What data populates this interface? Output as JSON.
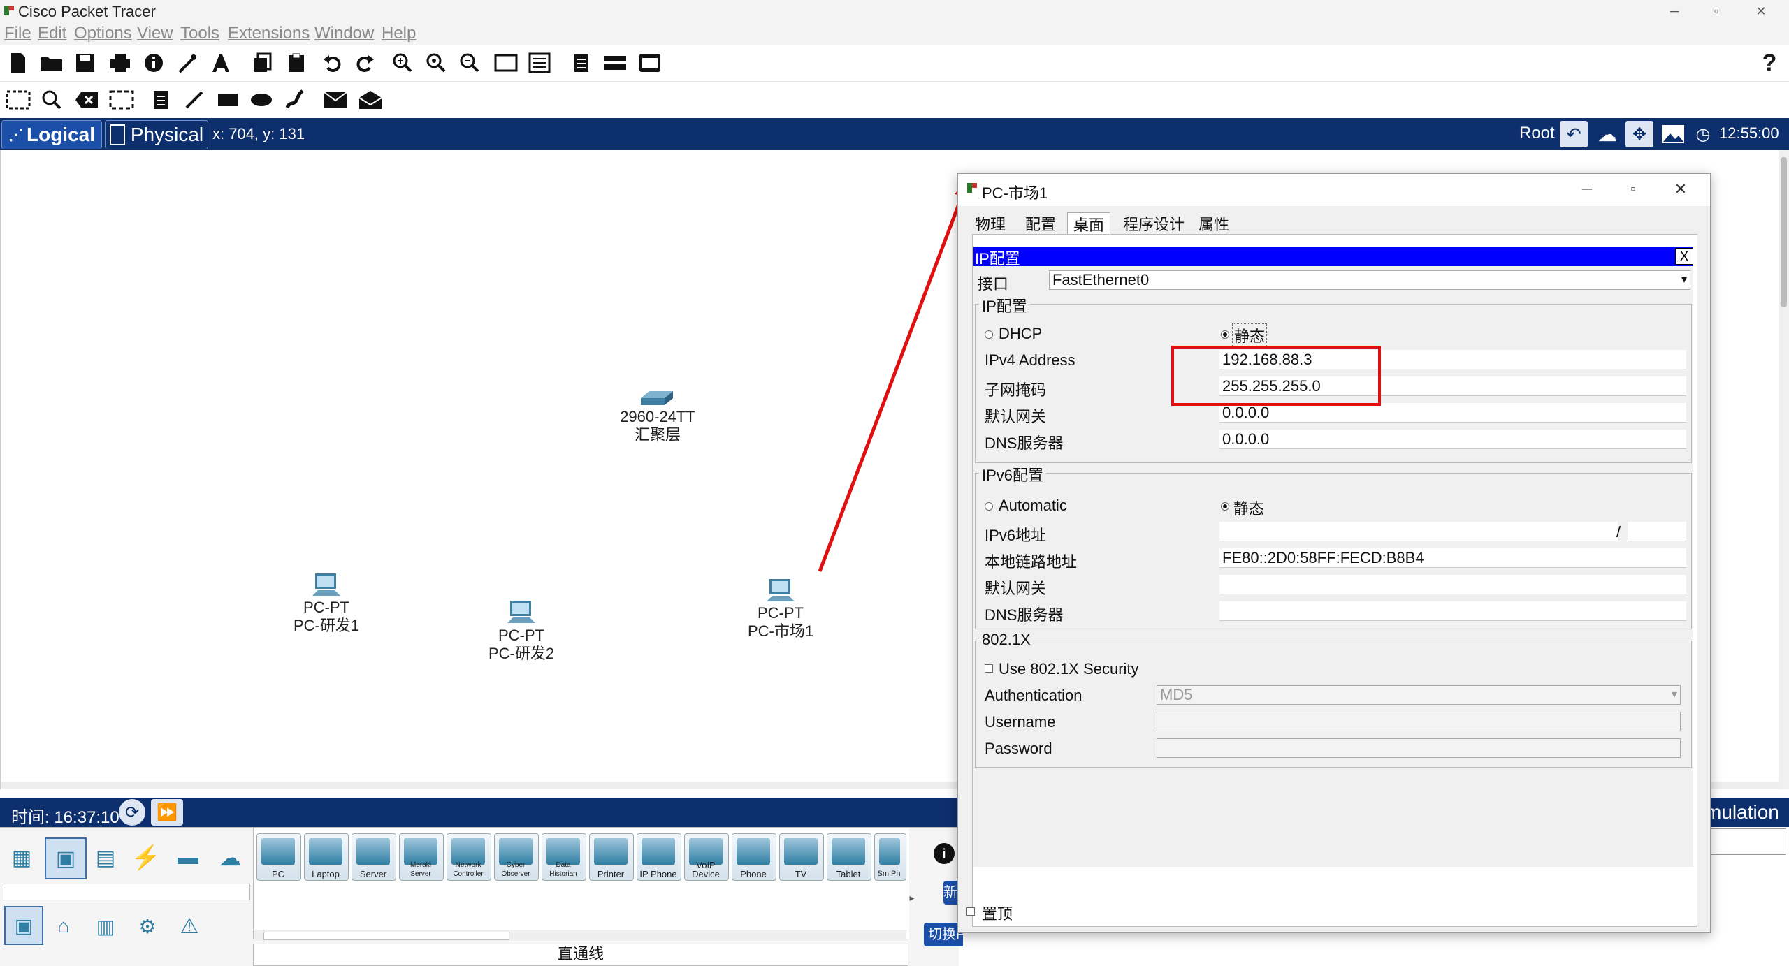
{
  "app": {
    "title": "Cisco Packet Tracer"
  },
  "menu": [
    "File",
    "Edit",
    "Options",
    "View",
    "Tools",
    "Extensions",
    "Window",
    "Help"
  ],
  "nav": {
    "logical_label": "Logical",
    "physical_label": "Physical",
    "coords": "x: 704, y: 131",
    "root_label": "Root",
    "clock": "12:55:00"
  },
  "devices": [
    {
      "model": "2960-24TT",
      "name": "汇聚层"
    },
    {
      "model": "PC-PT",
      "name": "PC-研发1"
    },
    {
      "model": "PC-PT",
      "name": "PC-研发2"
    },
    {
      "model": "PC-PT",
      "name": "PC-市场1"
    }
  ],
  "timebar": {
    "time_label": "时间: 16:37:10",
    "mode_label": "mulation"
  },
  "device_types": [
    "PC",
    "Laptop",
    "Server",
    "Meraki Server",
    "Network Controller",
    "Cyber Observer",
    "Data Historian",
    "Printer",
    "IP Phone",
    "VoIP Device",
    "Phone",
    "TV",
    "Tablet",
    "Sm Ph"
  ],
  "bottom": {
    "connection_label": "直通线",
    "pdu_button": "切换PDU列表窗口",
    "new_button": "新"
  },
  "dialog": {
    "title": "PC-市场1",
    "tabs": [
      "物理",
      "配置",
      "桌面",
      "程序设计",
      "属性"
    ],
    "active_tab": "桌面",
    "panel_title": "IP配置",
    "close_x": "X",
    "interface_label": "接口",
    "interface_value": "FastEthernet0",
    "ipv4": {
      "group_title": "IP配置",
      "dhcp_label": "DHCP",
      "static_label": "静态",
      "ipv4_label": "IPv4 Address",
      "ipv4_value": "192.168.88.3",
      "mask_label": "子网掩码",
      "mask_value": "255.255.255.0",
      "gateway_label": "默认网关",
      "gateway_value": "0.0.0.0",
      "dns_label": "DNS服务器",
      "dns_value": "0.0.0.0"
    },
    "ipv6": {
      "group_title": "IPv6配置",
      "auto_label": "Automatic",
      "static_label": "静态",
      "addr_label": "IPv6地址",
      "addr_value": "",
      "slash": "/",
      "link_local_label": "本地链路地址",
      "link_local_value": "FE80::2D0:58FF:FECD:B8B4",
      "gateway_label": "默认网关",
      "dns_label": "DNS服务器"
    },
    "dot1x": {
      "group_title": "802.1X",
      "use_label": "Use 802.1X Security",
      "auth_label": "Authentication",
      "auth_value": "MD5",
      "user_label": "Username",
      "pass_label": "Password"
    },
    "pin_label": "置顶"
  }
}
